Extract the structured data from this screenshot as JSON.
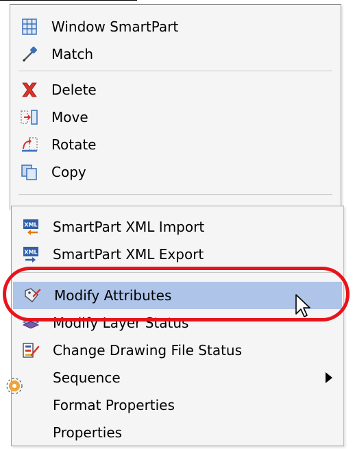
{
  "menu_top": {
    "items": [
      {
        "label": "Window SmartPart",
        "icon": "window-smartpart-icon"
      },
      {
        "label": "Match",
        "icon": "eyedropper-icon"
      },
      {
        "label": "Delete",
        "icon": "delete-x-icon"
      },
      {
        "label": "Move",
        "icon": "move-icon"
      },
      {
        "label": "Rotate",
        "icon": "rotate-icon"
      },
      {
        "label": "Copy",
        "icon": "copy-icon"
      }
    ]
  },
  "menu_bottom": {
    "items": [
      {
        "label": "SmartPart XML Import",
        "icon": "xml-import-icon"
      },
      {
        "label": "SmartPart XML Export",
        "icon": "xml-export-icon"
      },
      {
        "label": "Modify Attributes",
        "icon": "modify-attributes-icon",
        "highlighted": true
      },
      {
        "label": "Modify Layer Status",
        "icon": "layer-status-icon"
      },
      {
        "label": "Change Drawing File Status",
        "icon": "drawing-file-status-icon"
      },
      {
        "label": "Sequence",
        "icon": "submenu-arrow-icon",
        "has_submenu": true
      },
      {
        "label": "Format Properties",
        "icon": ""
      },
      {
        "label": "Properties",
        "icon": ""
      }
    ]
  },
  "colors": {
    "highlight": "#aec4e9",
    "annotation_ring": "#e8141b",
    "menu_background": "#f5f5f5"
  }
}
